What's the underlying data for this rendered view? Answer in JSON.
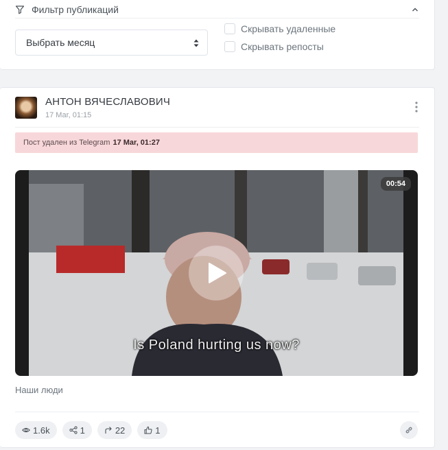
{
  "filter": {
    "title": "Фильтр публикаций",
    "month_select": {
      "value": "Выбрать месяц"
    },
    "hide_deleted_label": "Скрывать удаленные",
    "hide_reposts_label": "Скрывать репосты"
  },
  "post": {
    "author": "АНТОН ВЯЧЕСЛАВОВИЧ",
    "date": "17 Mar, 01:15",
    "deleted_notice": {
      "text": "Пост удален из Telegram",
      "time": "17 Mar, 01:27"
    },
    "video": {
      "duration": "00:54",
      "subtitle": "Is Poland hurting us now?"
    },
    "caption": "Наши люди",
    "stats": {
      "views": "1.6k",
      "shares": "1",
      "reposts": "22",
      "likes": "1"
    }
  },
  "colors": {
    "background": "#f1f3f5",
    "card": "#ffffff",
    "deleted_banner": "#f8d7da",
    "pill": "#eef0f3"
  },
  "icons": [
    "filter-icon",
    "chevron-up-icon",
    "select-arrows-icon",
    "more-vertical-icon",
    "play-icon",
    "eye-icon",
    "share-icon",
    "repost-icon",
    "thumbs-up-icon",
    "link-icon"
  ]
}
